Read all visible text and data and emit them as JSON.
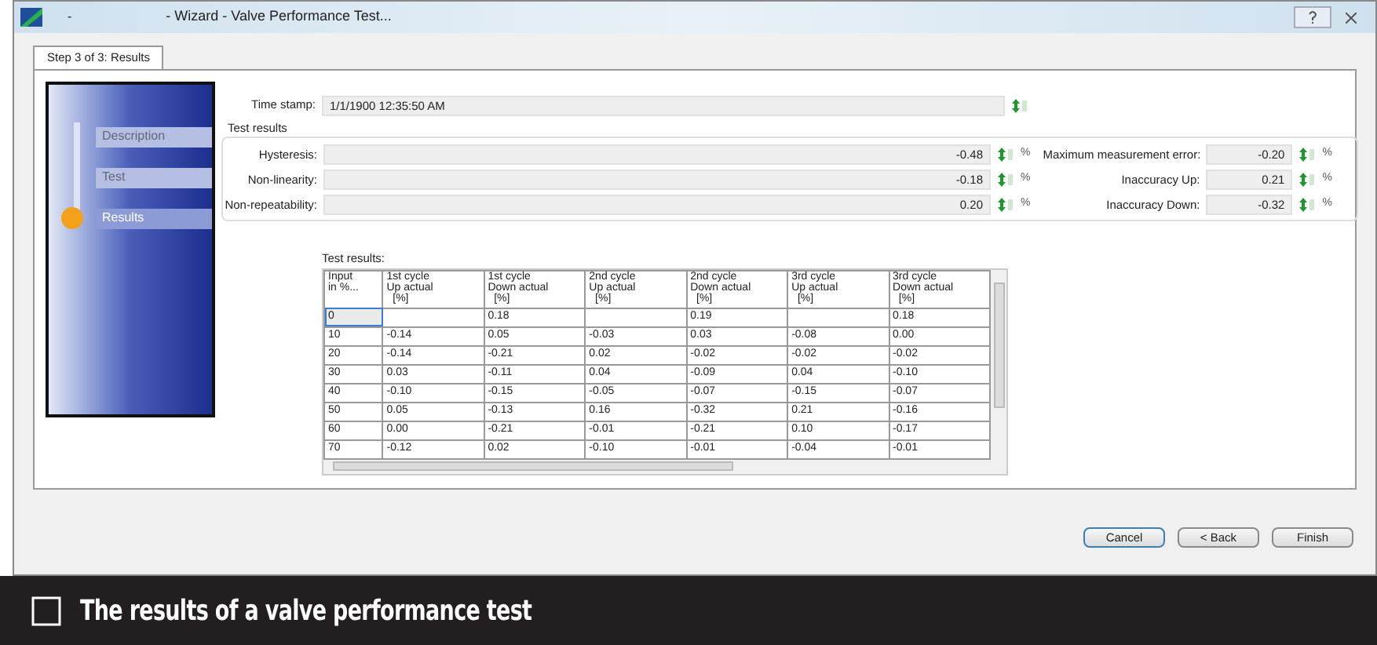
{
  "window": {
    "title_prefix": "-",
    "title": "- Wizard - Valve Performance Test..."
  },
  "tab": {
    "label": "Step 3 of 3: Results",
    "selected": true
  },
  "steps": [
    {
      "label": "Description",
      "selected": false
    },
    {
      "label": "Test",
      "selected": false
    },
    {
      "label": "Results",
      "selected": true
    }
  ],
  "time_stamp": {
    "label": "Time stamp:",
    "value": "1/1/1900 12:35:50 AM"
  },
  "test_results": {
    "title": "Test results",
    "left": [
      {
        "label": "Hysteresis:",
        "value": "-0.48",
        "unit": "%"
      },
      {
        "label": "Non-linearity:",
        "value": "-0.18",
        "unit": "%"
      },
      {
        "label": "Non-repeatability:",
        "value": "0.20",
        "unit": "%"
      }
    ],
    "right": [
      {
        "label": "Maximum measurement error:",
        "value": "-0.20",
        "unit": "%"
      },
      {
        "label": "Inaccuracy Up:",
        "value": "0.21",
        "unit": "%"
      },
      {
        "label": "Inaccuracy Down:",
        "value": "-0.32",
        "unit": "%"
      }
    ]
  },
  "table": {
    "title": "Test results:",
    "columns": [
      "Input\nin %...",
      "1st cycle\nUp actual\n  [%]",
      "1st cycle\nDown actual\n  [%]",
      "2nd cycle\nUp actual\n  [%]",
      "2nd cycle\nDown actual\n  [%]",
      "3rd cycle\nUp actual\n  [%]",
      "3rd cycle\nDown actual\n  [%]"
    ],
    "rows": [
      {
        "selected": true,
        "cells": [
          "0",
          "",
          "0.18",
          "",
          "0.19",
          "",
          "0.18"
        ]
      },
      {
        "selected": false,
        "cells": [
          "10",
          "-0.14",
          "0.05",
          "-0.03",
          "0.03",
          "-0.08",
          "0.00"
        ]
      },
      {
        "selected": false,
        "cells": [
          "20",
          "-0.14",
          "-0.21",
          "0.02",
          "-0.02",
          "-0.02",
          "-0.02"
        ]
      },
      {
        "selected": false,
        "cells": [
          "30",
          "0.03",
          "-0.11",
          "0.04",
          "-0.09",
          "0.04",
          "-0.10"
        ]
      },
      {
        "selected": false,
        "cells": [
          "40",
          "-0.10",
          "-0.15",
          "-0.05",
          "-0.07",
          "-0.15",
          "-0.07"
        ]
      },
      {
        "selected": false,
        "cells": [
          "50",
          "0.05",
          "-0.13",
          "0.16",
          "-0.32",
          "0.21",
          "-0.16"
        ]
      },
      {
        "selected": false,
        "cells": [
          "60",
          "0.00",
          "-0.21",
          "-0.01",
          "-0.21",
          "0.10",
          "-0.17"
        ]
      },
      {
        "selected": false,
        "cells": [
          "70",
          "-0.12",
          "0.02",
          "-0.10",
          "-0.01",
          "-0.04",
          "-0.01"
        ]
      }
    ]
  },
  "buttons": [
    {
      "label": "Cancel",
      "default": true
    },
    {
      "label": "< Back",
      "default": false
    },
    {
      "label": "Finish",
      "default": false
    }
  ],
  "caption": "The results of a valve performance test"
}
